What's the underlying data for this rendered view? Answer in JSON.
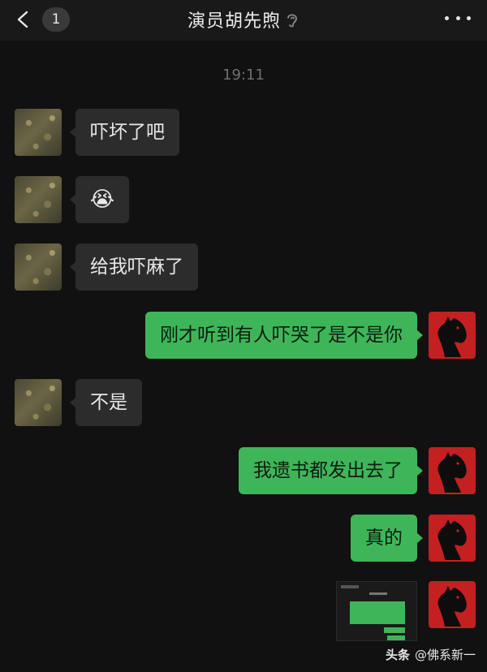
{
  "header": {
    "back_icon": "chevron-left-icon",
    "unread_count": "1",
    "title": "演员胡先煦",
    "ear_icon": "ear-icon",
    "more_icon": "more-icon"
  },
  "chat": {
    "time": "19:11",
    "messages": [
      {
        "from": "friend",
        "text": "吓坏了吧"
      },
      {
        "from": "friend",
        "emoji": "😭"
      },
      {
        "from": "friend",
        "text": "给我吓麻了"
      },
      {
        "from": "self",
        "text": "刚才听到有人吓哭了是不是你"
      },
      {
        "from": "friend",
        "text": "不是"
      },
      {
        "from": "self",
        "text": "我遗书都发出去了"
      },
      {
        "from": "self",
        "text": "真的"
      },
      {
        "from": "self",
        "image": "chat-screenshot-thumbnail"
      }
    ]
  },
  "watermark": {
    "logo": "头条",
    "handle": "@佛系新一"
  },
  "colors": {
    "background": "#111111",
    "header": "#191919",
    "incoming_bubble": "#2c2c2c",
    "outgoing_bubble": "#3eb559",
    "self_avatar": "#c42021"
  }
}
